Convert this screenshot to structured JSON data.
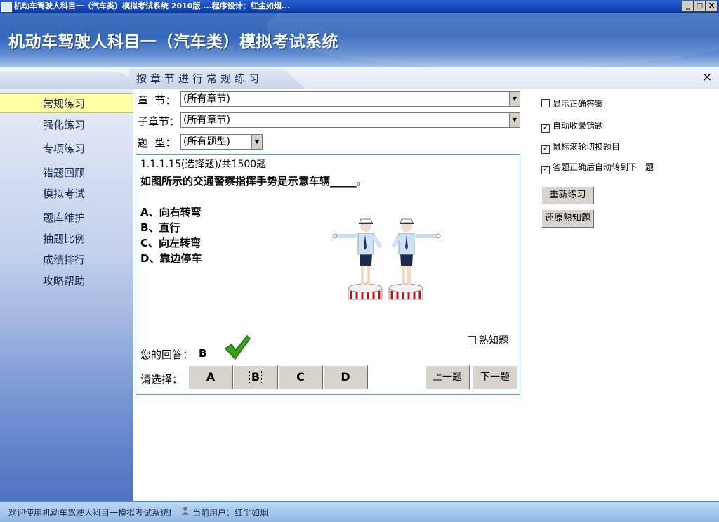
{
  "window": {
    "title": "机动车驾驶人科目一（汽车类）模拟考试系统 2010版 ...程序设计：红尘如烟...",
    "min_label": "_",
    "max_label": "□",
    "close_label": "X"
  },
  "header": {
    "app_title": "机动车驾驶人科目一（汽车类）模拟考试系统"
  },
  "tab": {
    "label": "按章节进行常规练习",
    "close": "×"
  },
  "sidebar": {
    "items": [
      {
        "label": "常规练习",
        "active": true
      },
      {
        "label": "强化练习"
      },
      {
        "label": "专项练习"
      },
      {
        "label": "错题回顾"
      },
      {
        "label": "模拟考试"
      },
      {
        "label": "题库维护"
      },
      {
        "label": "抽题比例"
      },
      {
        "label": "成绩排行"
      },
      {
        "label": "攻略帮助"
      }
    ]
  },
  "filters": {
    "chapter_label": "章  节：",
    "chapter_value": "(所有章节)",
    "subchapter_label": "子章节：",
    "subchapter_value": "(所有章节)",
    "type_label": "题  型：",
    "type_value": "(所有题型)"
  },
  "question": {
    "id_line": "1.1.1.15(选择题)/共1500题",
    "text": "如图所示的交通警察指挥手势是示意车辆_____。",
    "options": [
      "A、向右转弯",
      "B、直行",
      "C、向左转弯",
      "D、靠边停车"
    ],
    "familiar_label": "熟知题",
    "answer_label": "您的回答：",
    "answer_value": "B",
    "choose_label": "请选择：",
    "choices": [
      "A",
      "B",
      "C",
      "D"
    ],
    "selected": "B",
    "prev_label": "上一题",
    "next_label": "下一题"
  },
  "settings": {
    "show_answer": {
      "label": "显示正确答案",
      "checked": false
    },
    "auto_collect": {
      "label": "自动收录错题",
      "checked": true
    },
    "wheel_switch": {
      "label": "鼠标滚轮切换题目",
      "checked": true
    },
    "auto_next": {
      "label": "答题正确后自动转到下一题",
      "checked": true
    },
    "restart_label": "重新练习",
    "restore_label": "还原熟知题"
  },
  "status": {
    "welcome": "欢迎使用机动车驾驶人科目一模拟考试系统!",
    "user": "当前用户：红尘如烟"
  },
  "colors": {
    "accent": "#3568bb",
    "active_nav": "#ffffa6",
    "frame_border": "#3fb6c8",
    "check_green": "#3aa31e"
  }
}
